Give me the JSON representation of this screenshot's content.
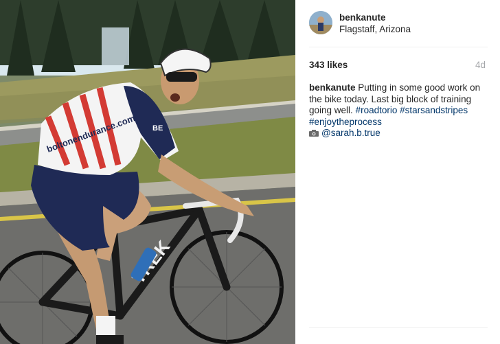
{
  "post": {
    "username": "benkanute",
    "location": "Flagstaff, Arizona",
    "likes": "343 likes",
    "age": "4d"
  },
  "caption": {
    "username": "benkanute",
    "text": "Putting in some good work on the bike today. Last big block of training going well.",
    "hashtags": [
      "#roadtorio",
      "#starsandstripes",
      "#enjoytheprocess"
    ],
    "camera_icon": "camera-icon",
    "mention": "@sarah.b.true"
  },
  "photo": {
    "jersey_text": "boltonendurance.com",
    "bike_brand": "TREK",
    "jersey_chest_text": "BE"
  },
  "colors": {
    "hashtag": "#003569",
    "muted": "#a5a7aa",
    "divider": "#efefef"
  }
}
